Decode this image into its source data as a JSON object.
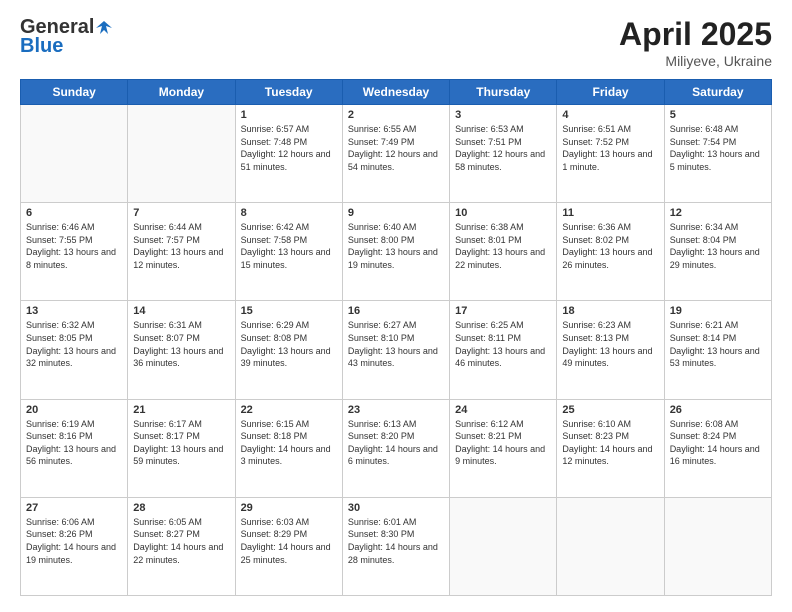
{
  "header": {
    "logo_general": "General",
    "logo_blue": "Blue",
    "title": "April 2025",
    "location": "Miliyeve, Ukraine"
  },
  "weekdays": [
    "Sunday",
    "Monday",
    "Tuesday",
    "Wednesday",
    "Thursday",
    "Friday",
    "Saturday"
  ],
  "weeks": [
    [
      {
        "day": "",
        "info": ""
      },
      {
        "day": "",
        "info": ""
      },
      {
        "day": "1",
        "info": "Sunrise: 6:57 AM\nSunset: 7:48 PM\nDaylight: 12 hours and 51 minutes."
      },
      {
        "day": "2",
        "info": "Sunrise: 6:55 AM\nSunset: 7:49 PM\nDaylight: 12 hours and 54 minutes."
      },
      {
        "day": "3",
        "info": "Sunrise: 6:53 AM\nSunset: 7:51 PM\nDaylight: 12 hours and 58 minutes."
      },
      {
        "day": "4",
        "info": "Sunrise: 6:51 AM\nSunset: 7:52 PM\nDaylight: 13 hours and 1 minute."
      },
      {
        "day": "5",
        "info": "Sunrise: 6:48 AM\nSunset: 7:54 PM\nDaylight: 13 hours and 5 minutes."
      }
    ],
    [
      {
        "day": "6",
        "info": "Sunrise: 6:46 AM\nSunset: 7:55 PM\nDaylight: 13 hours and 8 minutes."
      },
      {
        "day": "7",
        "info": "Sunrise: 6:44 AM\nSunset: 7:57 PM\nDaylight: 13 hours and 12 minutes."
      },
      {
        "day": "8",
        "info": "Sunrise: 6:42 AM\nSunset: 7:58 PM\nDaylight: 13 hours and 15 minutes."
      },
      {
        "day": "9",
        "info": "Sunrise: 6:40 AM\nSunset: 8:00 PM\nDaylight: 13 hours and 19 minutes."
      },
      {
        "day": "10",
        "info": "Sunrise: 6:38 AM\nSunset: 8:01 PM\nDaylight: 13 hours and 22 minutes."
      },
      {
        "day": "11",
        "info": "Sunrise: 6:36 AM\nSunset: 8:02 PM\nDaylight: 13 hours and 26 minutes."
      },
      {
        "day": "12",
        "info": "Sunrise: 6:34 AM\nSunset: 8:04 PM\nDaylight: 13 hours and 29 minutes."
      }
    ],
    [
      {
        "day": "13",
        "info": "Sunrise: 6:32 AM\nSunset: 8:05 PM\nDaylight: 13 hours and 32 minutes."
      },
      {
        "day": "14",
        "info": "Sunrise: 6:31 AM\nSunset: 8:07 PM\nDaylight: 13 hours and 36 minutes."
      },
      {
        "day": "15",
        "info": "Sunrise: 6:29 AM\nSunset: 8:08 PM\nDaylight: 13 hours and 39 minutes."
      },
      {
        "day": "16",
        "info": "Sunrise: 6:27 AM\nSunset: 8:10 PM\nDaylight: 13 hours and 43 minutes."
      },
      {
        "day": "17",
        "info": "Sunrise: 6:25 AM\nSunset: 8:11 PM\nDaylight: 13 hours and 46 minutes."
      },
      {
        "day": "18",
        "info": "Sunrise: 6:23 AM\nSunset: 8:13 PM\nDaylight: 13 hours and 49 minutes."
      },
      {
        "day": "19",
        "info": "Sunrise: 6:21 AM\nSunset: 8:14 PM\nDaylight: 13 hours and 53 minutes."
      }
    ],
    [
      {
        "day": "20",
        "info": "Sunrise: 6:19 AM\nSunset: 8:16 PM\nDaylight: 13 hours and 56 minutes."
      },
      {
        "day": "21",
        "info": "Sunrise: 6:17 AM\nSunset: 8:17 PM\nDaylight: 13 hours and 59 minutes."
      },
      {
        "day": "22",
        "info": "Sunrise: 6:15 AM\nSunset: 8:18 PM\nDaylight: 14 hours and 3 minutes."
      },
      {
        "day": "23",
        "info": "Sunrise: 6:13 AM\nSunset: 8:20 PM\nDaylight: 14 hours and 6 minutes."
      },
      {
        "day": "24",
        "info": "Sunrise: 6:12 AM\nSunset: 8:21 PM\nDaylight: 14 hours and 9 minutes."
      },
      {
        "day": "25",
        "info": "Sunrise: 6:10 AM\nSunset: 8:23 PM\nDaylight: 14 hours and 12 minutes."
      },
      {
        "day": "26",
        "info": "Sunrise: 6:08 AM\nSunset: 8:24 PM\nDaylight: 14 hours and 16 minutes."
      }
    ],
    [
      {
        "day": "27",
        "info": "Sunrise: 6:06 AM\nSunset: 8:26 PM\nDaylight: 14 hours and 19 minutes."
      },
      {
        "day": "28",
        "info": "Sunrise: 6:05 AM\nSunset: 8:27 PM\nDaylight: 14 hours and 22 minutes."
      },
      {
        "day": "29",
        "info": "Sunrise: 6:03 AM\nSunset: 8:29 PM\nDaylight: 14 hours and 25 minutes."
      },
      {
        "day": "30",
        "info": "Sunrise: 6:01 AM\nSunset: 8:30 PM\nDaylight: 14 hours and 28 minutes."
      },
      {
        "day": "",
        "info": ""
      },
      {
        "day": "",
        "info": ""
      },
      {
        "day": "",
        "info": ""
      }
    ]
  ]
}
